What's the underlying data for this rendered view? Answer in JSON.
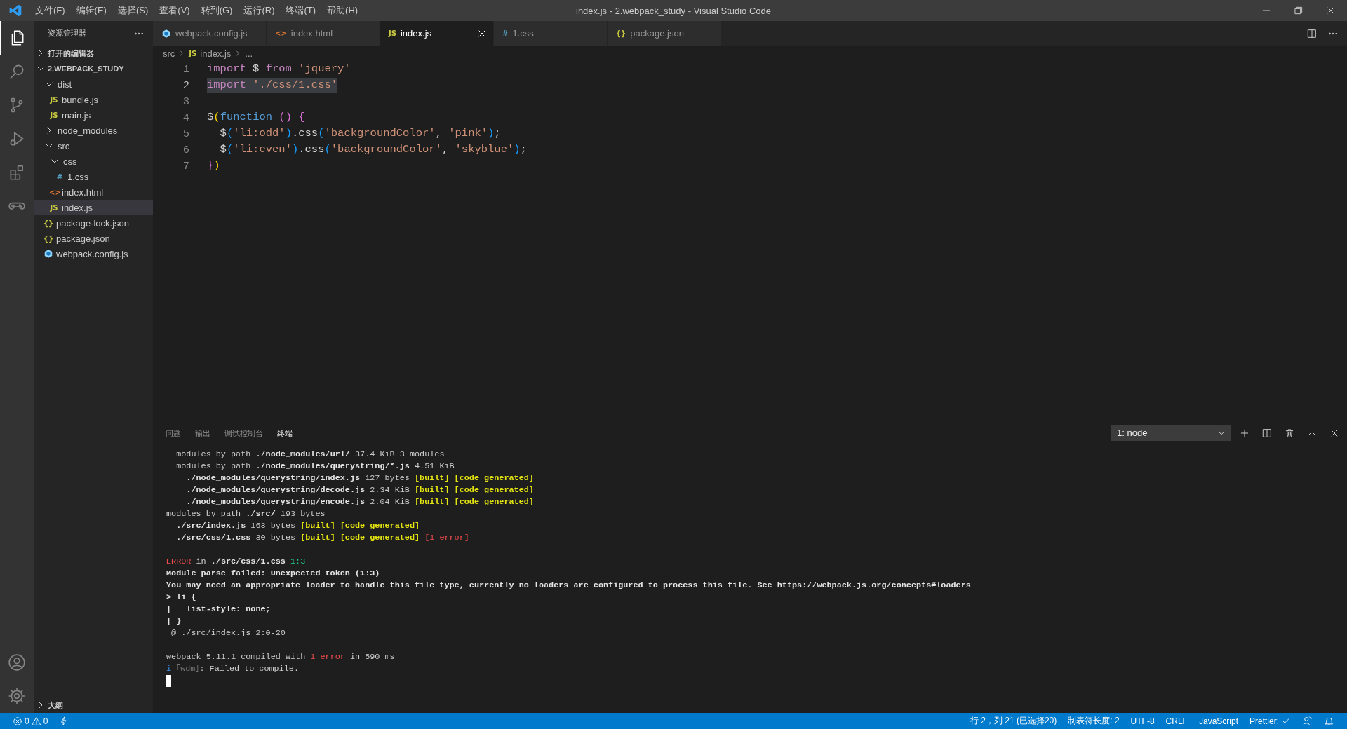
{
  "window": {
    "title": "index.js - 2.webpack_study - Visual Studio Code"
  },
  "menu": [
    "文件(F)",
    "编辑(E)",
    "选择(S)",
    "查看(V)",
    "转到(G)",
    "运行(R)",
    "终端(T)",
    "帮助(H)"
  ],
  "activity_bar": [
    {
      "kind": "files",
      "selected": true
    },
    {
      "kind": "search",
      "selected": false
    },
    {
      "kind": "branch",
      "selected": false
    },
    {
      "kind": "run",
      "selected": false
    },
    {
      "kind": "extensions",
      "selected": false
    },
    {
      "kind": "gamepad",
      "selected": false
    }
  ],
  "activity_bottom": [
    {
      "kind": "account"
    },
    {
      "kind": "settings"
    }
  ],
  "sidebar": {
    "title": "资源管理器",
    "sections": [
      {
        "label": "打开的编辑器",
        "expanded": false
      },
      {
        "label": "2.WEBPACK_STUDY",
        "expanded": true,
        "children": [
          {
            "label": "dist",
            "kind": "folder",
            "expanded": true,
            "selected": false,
            "children": [
              {
                "label": "bundle.js",
                "kind": "js",
                "icon": "JS",
                "selected": false
              },
              {
                "label": "main.js",
                "kind": "js",
                "icon": "JS",
                "selected": false
              }
            ]
          },
          {
            "label": "node_modules",
            "kind": "folder",
            "expanded": false,
            "selected": false
          },
          {
            "label": "src",
            "kind": "folder",
            "expanded": true,
            "selected": false,
            "children": [
              {
                "label": "css",
                "kind": "folder",
                "expanded": true,
                "selected": false,
                "children": [
                  {
                    "label": "1.css",
                    "kind": "css",
                    "icon": "#",
                    "selected": false
                  }
                ]
              },
              {
                "label": "index.html",
                "kind": "html",
                "icon": "<>",
                "selected": false
              },
              {
                "label": "index.js",
                "kind": "js",
                "icon": "JS",
                "selected": true
              }
            ]
          },
          {
            "label": "package-lock.json",
            "kind": "json",
            "icon": "{}",
            "selected": false
          },
          {
            "label": "package.json",
            "kind": "json",
            "icon": "{}",
            "selected": false
          },
          {
            "label": "webpack.config.js",
            "kind": "webpack",
            "selected": false
          }
        ]
      }
    ],
    "outline": {
      "label": "大纲",
      "expanded": false
    }
  },
  "tabs": [
    {
      "label": "webpack.config.js",
      "kind": "webpack",
      "selected": false
    },
    {
      "label": "index.html",
      "kind": "html",
      "icon": "<>",
      "selected": false
    },
    {
      "label": "index.js",
      "kind": "js",
      "icon": "JS",
      "selected": true
    },
    {
      "label": "1.css",
      "kind": "css",
      "icon": "#",
      "selected": false
    },
    {
      "label": "package.json",
      "kind": "json",
      "icon": "{}",
      "selected": false
    }
  ],
  "breadcrumbs": [
    {
      "label": "src",
      "kind": "folder"
    },
    {
      "label": "index.js",
      "kind": "js",
      "icon": "JS"
    },
    {
      "label": "...",
      "kind": "more"
    }
  ],
  "code_lines": [
    {
      "number": "1",
      "selected": false,
      "tokens": [
        {
          "kind": "kw",
          "text": "import"
        },
        {
          "kind": "plain",
          "text": " $ "
        },
        {
          "kind": "kw",
          "text": "from "
        },
        {
          "kind": "str",
          "text": "'jquery'"
        }
      ]
    },
    {
      "number": "2",
      "selected": true,
      "tokens": [
        {
          "kind": "kw",
          "text": "import "
        },
        {
          "kind": "str",
          "text": "'./css/1.css'"
        }
      ]
    },
    {
      "number": "3",
      "selected": false
    },
    {
      "number": "4",
      "selected": false,
      "tokens": [
        {
          "kind": "plain",
          "text": "$"
        },
        {
          "kind": "b1",
          "text": "("
        },
        {
          "kind": "fn",
          "text": "function "
        },
        {
          "kind": "b2",
          "text": "() {"
        }
      ]
    },
    {
      "number": "5",
      "selected": false,
      "tokens": [
        {
          "kind": "plain",
          "text": "  $"
        },
        {
          "kind": "b3",
          "text": "("
        },
        {
          "kind": "str",
          "text": "'li:odd'"
        },
        {
          "kind": "b3",
          "text": ")"
        },
        {
          "kind": "plain",
          "text": ".css"
        },
        {
          "kind": "b3",
          "text": "("
        },
        {
          "kind": "str",
          "text": "'backgroundColor'"
        },
        {
          "kind": "plain",
          "text": ", "
        },
        {
          "kind": "str",
          "text": "'pink'"
        },
        {
          "kind": "b3",
          "text": ")"
        },
        {
          "kind": "plain",
          "text": ";"
        }
      ]
    },
    {
      "number": "6",
      "selected": false,
      "tokens": [
        {
          "kind": "plain",
          "text": "  $"
        },
        {
          "kind": "b3",
          "text": "("
        },
        {
          "kind": "str",
          "text": "'li:even'"
        },
        {
          "kind": "b3",
          "text": ")"
        },
        {
          "kind": "plain",
          "text": ".css"
        },
        {
          "kind": "b3",
          "text": "("
        },
        {
          "kind": "str",
          "text": "'backgroundColor'"
        },
        {
          "kind": "plain",
          "text": ", "
        },
        {
          "kind": "str",
          "text": "'skyblue'"
        },
        {
          "kind": "b3",
          "text": ")"
        },
        {
          "kind": "plain",
          "text": ";"
        }
      ]
    },
    {
      "number": "7",
      "selected": false,
      "tokens": [
        {
          "kind": "b2",
          "text": "}"
        },
        {
          "kind": "b1",
          "text": ")"
        }
      ]
    }
  ],
  "panel": {
    "tabs": [
      {
        "label": "问题",
        "selected": false
      },
      {
        "label": "输出",
        "selected": false
      },
      {
        "label": "调试控制台",
        "selected": false
      },
      {
        "label": "终端",
        "selected": true
      }
    ],
    "terminal_select": "1: node",
    "terminal_lines": [
      {
        "kind": "text",
        "segments": [
          {
            "kind": "plain",
            "text": "  modules by path "
          },
          {
            "kind": "bold",
            "text": "./node_modules/url/"
          },
          {
            "kind": "plain",
            "text": " 37.4 KiB 3 modules"
          }
        ]
      },
      {
        "kind": "text",
        "segments": [
          {
            "kind": "plain",
            "text": "  modules by path "
          },
          {
            "kind": "bold",
            "text": "./node_modules/querystring/*.js"
          },
          {
            "kind": "plain",
            "text": " 4.51 KiB"
          }
        ]
      },
      {
        "kind": "text",
        "segments": [
          {
            "kind": "bold",
            "text": "    ./node_modules/querystring/index.js"
          },
          {
            "kind": "plain",
            "text": " 127 bytes "
          },
          {
            "kind": "yellow",
            "text": "[built] [code generated]"
          }
        ]
      },
      {
        "kind": "text",
        "segments": [
          {
            "kind": "bold",
            "text": "    ./node_modules/querystring/decode.js"
          },
          {
            "kind": "plain",
            "text": " 2.34 KiB "
          },
          {
            "kind": "yellow",
            "text": "[built] [code generated]"
          }
        ]
      },
      {
        "kind": "text",
        "segments": [
          {
            "kind": "bold",
            "text": "    ./node_modules/querystring/encode.js"
          },
          {
            "kind": "plain",
            "text": " 2.04 KiB "
          },
          {
            "kind": "yellow",
            "text": "[built] [code generated]"
          }
        ]
      },
      {
        "kind": "text",
        "segments": [
          {
            "kind": "plain",
            "text": "modules by path "
          },
          {
            "kind": "bold",
            "text": "./src/"
          },
          {
            "kind": "plain",
            "text": " 193 bytes"
          }
        ]
      },
      {
        "kind": "text",
        "segments": [
          {
            "kind": "bold",
            "text": "  ./src/index.js"
          },
          {
            "kind": "plain",
            "text": " 163 bytes "
          },
          {
            "kind": "yellow",
            "text": "[built] [code generated]"
          }
        ]
      },
      {
        "kind": "text",
        "segments": [
          {
            "kind": "bold",
            "text": "  ./src/css/1.css"
          },
          {
            "kind": "plain",
            "text": " 30 bytes "
          },
          {
            "kind": "yellow",
            "text": "[built] [code generated] "
          },
          {
            "kind": "red",
            "text": "[1 error]"
          }
        ]
      },
      {
        "kind": "blank"
      },
      {
        "kind": "text",
        "segments": [
          {
            "kind": "red",
            "text": "ERROR"
          },
          {
            "kind": "plain",
            "text": " in "
          },
          {
            "kind": "bold",
            "text": "./src/css/1.css "
          },
          {
            "kind": "green",
            "text": "1:3"
          }
        ]
      },
      {
        "kind": "text",
        "segments": [
          {
            "kind": "bold",
            "text": "Module parse failed: Unexpected token (1:3)"
          }
        ]
      },
      {
        "kind": "text",
        "segments": [
          {
            "kind": "bold",
            "text": "You may need an appropriate loader to handle this file type, currently no loaders are configured to process this file. See https://webpack.js.org/concepts#loaders"
          }
        ]
      },
      {
        "kind": "text",
        "segments": [
          {
            "kind": "bold",
            "text": "> li {"
          }
        ]
      },
      {
        "kind": "text",
        "segments": [
          {
            "kind": "bold",
            "text": "|   list-style: none;"
          }
        ]
      },
      {
        "kind": "text",
        "segments": [
          {
            "kind": "bold",
            "text": "| }"
          }
        ]
      },
      {
        "kind": "text",
        "segments": [
          {
            "kind": "plain",
            "text": " @ ./src/index.js 2:0-20"
          }
        ]
      },
      {
        "kind": "blank"
      },
      {
        "kind": "text",
        "segments": [
          {
            "kind": "plain",
            "text": "webpack 5.11.1 compiled with "
          },
          {
            "kind": "red",
            "text": "1 error"
          },
          {
            "kind": "plain",
            "text": " in 590 ms"
          }
        ]
      },
      {
        "kind": "text",
        "segments": [
          {
            "kind": "blue",
            "text": "i "
          },
          {
            "kind": "dim",
            "text": "｢wdm｣"
          },
          {
            "kind": "plain",
            "text": ": Failed to compile."
          }
        ]
      },
      {
        "kind": "cursor"
      }
    ]
  },
  "status_bar": {
    "errors": "0",
    "warnings": "0",
    "items": [
      "行 2，列 21 (已选择20)",
      "制表符长度: 2",
      "UTF-8",
      "CRLF",
      "JavaScript"
    ],
    "prettier": "Prettier:"
  }
}
